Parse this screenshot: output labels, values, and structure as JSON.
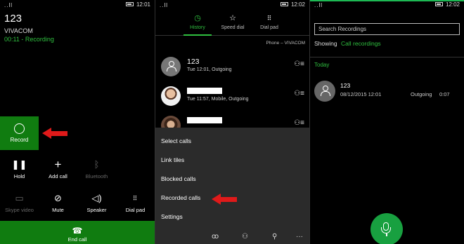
{
  "status": {
    "signal_p1": "..ll",
    "time_p1": "12:01",
    "signal_p2": "..ll",
    "time_p2": "12:02",
    "signal_p3": "..ll",
    "time_p3": "12:02"
  },
  "in_call": {
    "caller": "123",
    "carrier": "VIVACOM",
    "recording_status": "00:11 - Recording",
    "record_label": "Record",
    "controls": [
      {
        "label": "Hold",
        "icon": "pause-icon"
      },
      {
        "label": "Add call",
        "icon": "plus-icon"
      },
      {
        "label": "Bluetooth",
        "icon": "bluetooth-icon"
      },
      {
        "label": "Skype video",
        "icon": "video-icon"
      },
      {
        "label": "Mute",
        "icon": "mic-mute-icon"
      },
      {
        "label": "Speaker",
        "icon": "speaker-icon"
      },
      {
        "label": "Dial pad",
        "icon": "dialpad-icon"
      }
    ],
    "end_call_label": "End call"
  },
  "history": {
    "tabs": [
      {
        "label": "History",
        "icon": "clock-icon"
      },
      {
        "label": "Speed dial",
        "icon": "star-icon"
      },
      {
        "label": "Dial pad",
        "icon": "dialpad-icon"
      }
    ],
    "line_info": "Phone – VIVACOM",
    "calls": [
      {
        "name": "123",
        "detail": "Tue 12:01, Outgoing"
      },
      {
        "name": "",
        "detail": "Tue 11:57, Mobile, Outgoing"
      },
      {
        "name": "",
        "detail": ""
      }
    ],
    "menu": [
      "Select calls",
      "Link tiles",
      "Blocked calls",
      "Recorded calls",
      "Settings"
    ],
    "appbar": [
      {
        "icon": "voicemail-icon",
        "glyph": "ꝏ"
      },
      {
        "icon": "people-icon",
        "glyph": "⚇"
      },
      {
        "icon": "search-icon",
        "glyph": "⚲"
      },
      {
        "icon": "more-icon",
        "glyph": "···"
      }
    ]
  },
  "recordings": {
    "search_placeholder": "Search Recordings",
    "showing_label": "Showing",
    "filter_link": "Call recordings",
    "section": "Today",
    "items": [
      {
        "name": "123",
        "date": "08/12/2015 12:01",
        "direction": "Outgoing",
        "duration": "0:07"
      }
    ]
  },
  "colors": {
    "accent": "#2fbf3f",
    "tile": "#107c10",
    "arrow": "#e01a1a"
  }
}
